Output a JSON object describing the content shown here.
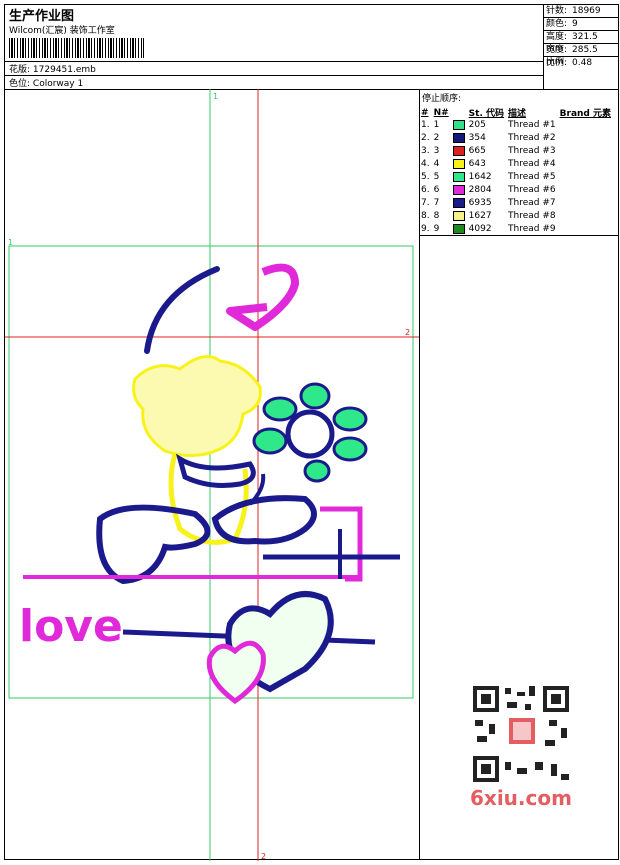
{
  "header": {
    "title": "生产作业图",
    "company": "Wilcom(汇宸) 装饰工作室",
    "pattern_label": "花版:",
    "pattern_value": "1729451.emb",
    "colorway_label": "色位:",
    "colorway_value": "Colorway 1"
  },
  "stats": [
    {
      "label": "针数:",
      "value": "18969"
    },
    {
      "label": "颜色:",
      "value": "9"
    },
    {
      "label": "高度:",
      "value": "321.5 mm"
    },
    {
      "label": "宽度:",
      "value": "285.5 mm"
    },
    {
      "label": "比例:",
      "value": "0.48"
    }
  ],
  "stop_sequence": {
    "title": "停止顺序:",
    "headers": {
      "num": "#",
      "n": "N#",
      "st": "St.",
      "code": "代码",
      "desc": "描述",
      "brand": "Brand",
      "element": "元素"
    },
    "rows": [
      {
        "num": "1.",
        "n": "1",
        "color": "#33e08a",
        "code": "205",
        "desc": "Thread #1"
      },
      {
        "num": "2.",
        "n": "2",
        "color": "#151a7a",
        "code": "354",
        "desc": "Thread #2"
      },
      {
        "num": "3.",
        "n": "3",
        "color": "#e02020",
        "code": "665",
        "desc": "Thread #3"
      },
      {
        "num": "4.",
        "n": "4",
        "color": "#f7f31a",
        "code": "643",
        "desc": "Thread #4"
      },
      {
        "num": "5.",
        "n": "5",
        "color": "#2ee88a",
        "code": "1642",
        "desc": "Thread #5"
      },
      {
        "num": "6.",
        "n": "6",
        "color": "#e029d9",
        "code": "2804",
        "desc": "Thread #6"
      },
      {
        "num": "7.",
        "n": "7",
        "color": "#1a1a8c",
        "code": "6935",
        "desc": "Thread #7"
      },
      {
        "num": "8.",
        "n": "8",
        "color": "#f5f08a",
        "code": "1627",
        "desc": "Thread #8"
      },
      {
        "num": "9.",
        "n": "9",
        "color": "#1c8a1c",
        "code": "4092",
        "desc": "Thread #9"
      }
    ]
  },
  "guides": {
    "marker_1": "1",
    "marker_2": "2"
  },
  "design": {
    "text": "love"
  },
  "watermark": {
    "site": "6xiu.com"
  }
}
